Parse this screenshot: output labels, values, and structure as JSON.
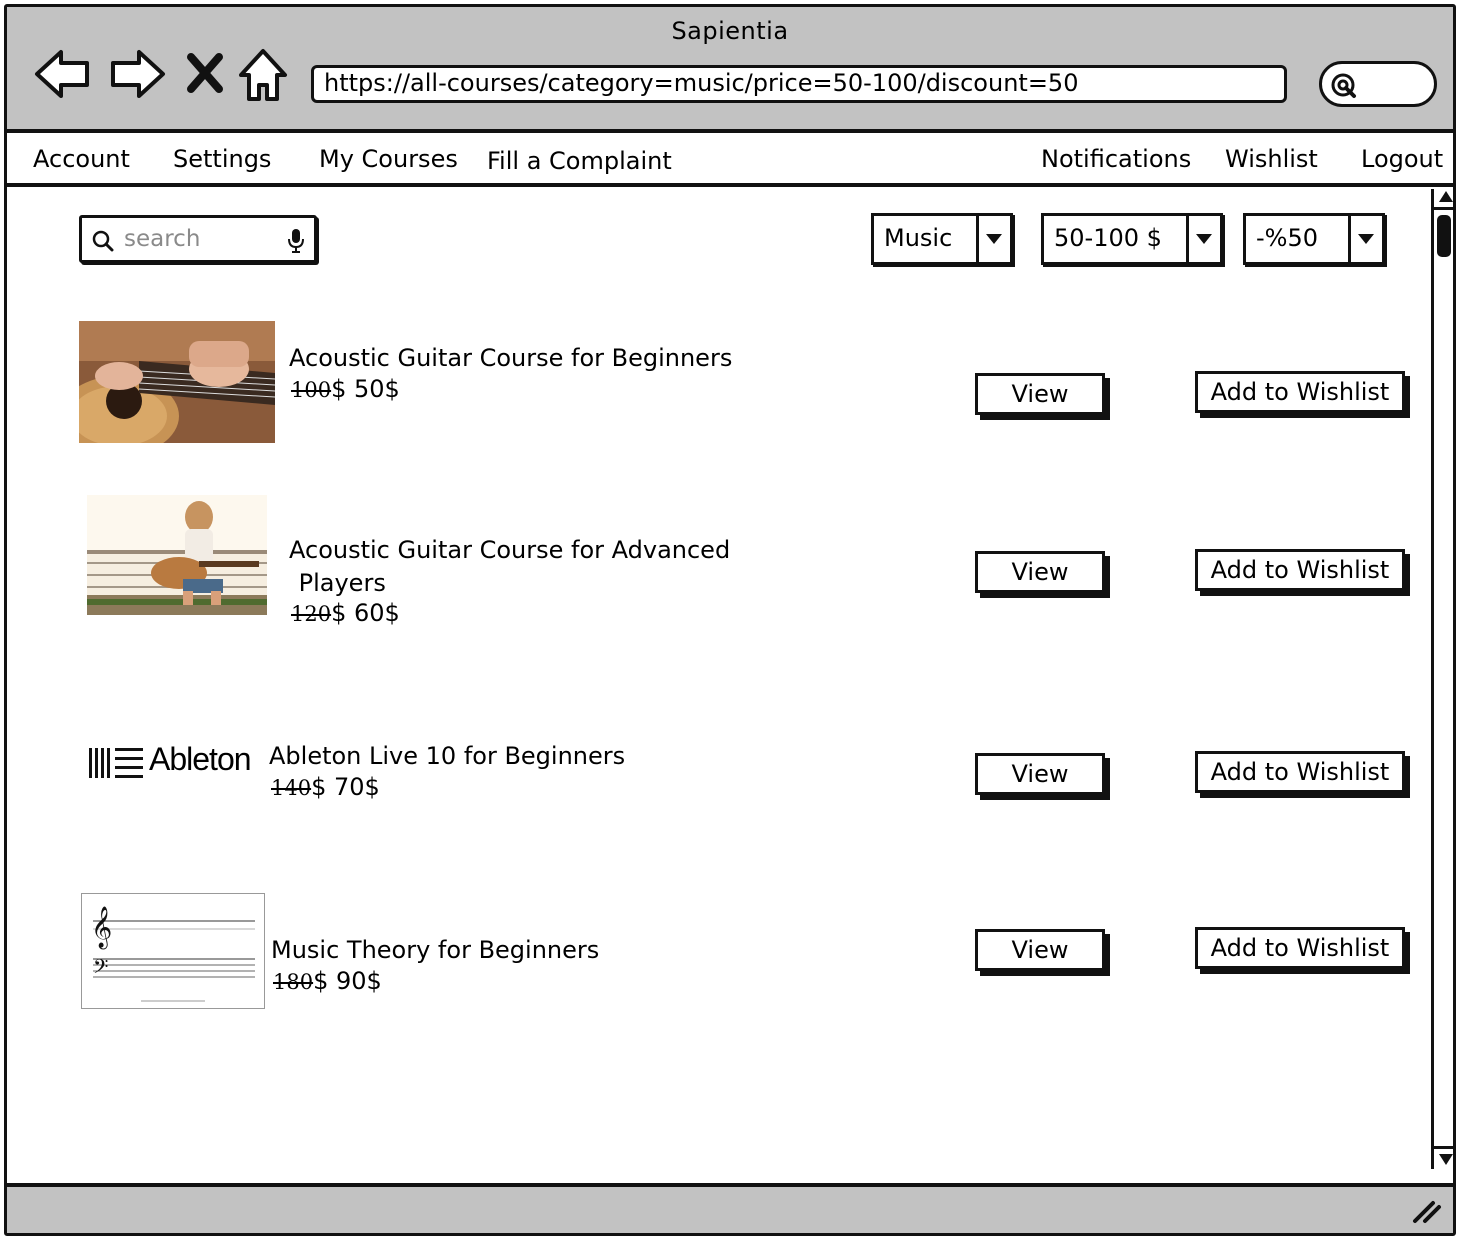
{
  "window": {
    "title": "Sapientia"
  },
  "browser": {
    "url": "https://all-courses/category=music/price=50-100/discount=50",
    "nav_icons": [
      "back-arrow-icon",
      "forward-arrow-icon",
      "stop-icon",
      "home-icon"
    ],
    "search_icon": "search-icon"
  },
  "menu": {
    "left": [
      "Account",
      "Settings",
      "My Courses",
      "Fill a Complaint"
    ],
    "right": [
      "Notifications",
      "Wishlist",
      "Logout"
    ]
  },
  "filters": {
    "search_placeholder": "search",
    "category": "Music",
    "price_range": "50-100 $",
    "discount": "-%50"
  },
  "courses": [
    {
      "title": "Acoustic Guitar Course for Beginners",
      "title_line2": "",
      "old_price": "100",
      "price_rest": "$ 50$",
      "thumbnail": "guitar-closeup-photo"
    },
    {
      "title": "Acoustic Guitar Course for Advanced",
      "title_line2": " Players",
      "old_price": "120",
      "price_rest": "$ 60$",
      "thumbnail": "woman-playing-guitar-photo"
    },
    {
      "title": "Ableton Live 10 for Beginners",
      "title_line2": "",
      "old_price": "140",
      "price_rest": "$ 70$",
      "thumbnail": "ableton-logo",
      "logo_text": "Ableton"
    },
    {
      "title": "Music Theory for Beginners",
      "title_line2": "",
      "old_price": "180",
      "price_rest": "$ 90$",
      "thumbnail": "music-staff-sheet"
    }
  ],
  "actions": {
    "view_label": "View",
    "wishlist_label": "Add to Wishlist"
  }
}
